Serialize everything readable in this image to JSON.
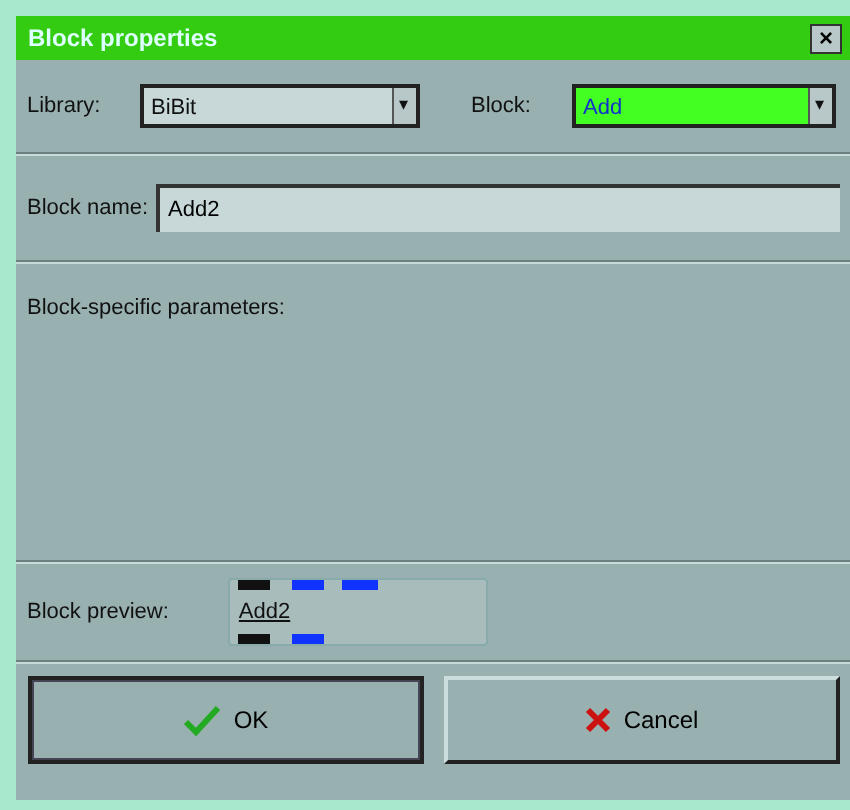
{
  "window": {
    "title": "Block properties",
    "close": "×"
  },
  "library": {
    "label": "Library:",
    "value": "BiBit",
    "arrow": "▾",
    "highlighted": false
  },
  "block": {
    "label": "Block:",
    "value": "Add",
    "arrow": "▾",
    "highlighted": true
  },
  "block_name": {
    "label": "Block name:",
    "value": "Add2"
  },
  "parameters": {
    "label": "Block-specific parameters:"
  },
  "preview": {
    "label": "Block preview:",
    "block_label": "Add2"
  },
  "buttons": [
    {
      "label": "OK",
      "kind": "ok"
    },
    {
      "label": "Cancel",
      "kind": "cancel"
    }
  ]
}
